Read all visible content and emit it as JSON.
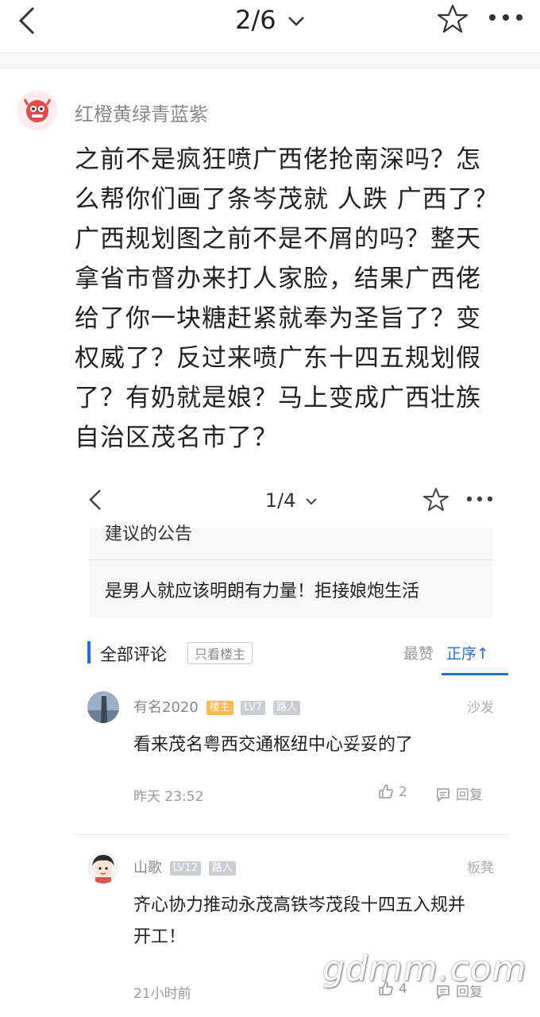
{
  "topbar": {
    "page_indicator": "2/6"
  },
  "post": {
    "author_name": "红橙黄绿青蓝紫",
    "body": "之前不是疯狂喷广西佬抢南深吗？怎么帮你们画了条岑茂就 人跌 广西了？广西规划图之前不是不屑的吗？整天拿省市督办来打人家脸，结果广西佬给了你一块糖赶紧就奉为圣旨了？变权威了？反过来喷广东十四五规划假了？有奶就是娘？马上变成广西壮族自治区茂名市了？"
  },
  "embed": {
    "page_indicator": "1/4",
    "notice_cut": "建议的公告",
    "notice_item": "是男人就应该明朗有力量！拒接娘炮生活",
    "comments_label": "全部评论",
    "only_host": "只看楼主",
    "sort_likes": "最赞",
    "sort_order": "正序↑",
    "comments": [
      {
        "name": "有名2020",
        "badges": [
          "楼主",
          "LV7",
          "路人"
        ],
        "floor": "沙发",
        "text": "看来茂名粤西交通枢纽中心妥妥的了",
        "time": "昨天 23:52",
        "likes": "2",
        "reply": "回复"
      },
      {
        "name": "山歌",
        "badges": [
          "LV12",
          "路人"
        ],
        "floor": "板凳",
        "text": "齐心协力推动永茂高铁岑茂段十四五入规并开工！",
        "time": "21小时前",
        "likes": "4",
        "reply": "回复"
      }
    ]
  },
  "watermark": "gdmm.com",
  "icons": {
    "back": "chevron-left-icon",
    "dropdown": "chevron-down-icon",
    "favorite": "star-icon",
    "more": "more-dots-icon",
    "like": "thumbs-up-icon",
    "reply": "comment-icon"
  },
  "colors": {
    "accent": "#1f6fe0",
    "host_badge": "#ffb84d",
    "level_badge": "#c9cdd4"
  }
}
